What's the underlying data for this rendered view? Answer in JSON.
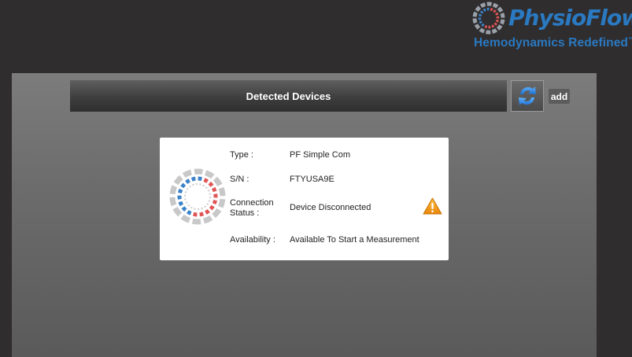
{
  "brand": {
    "name_part1": "Physio",
    "name_part2": "Flow",
    "registered": "®",
    "tagline": "Hemodynamics Redefined",
    "trademark": "™",
    "logo_icon": "physioflow-ring-logo",
    "colors": {
      "primary": "#2a79c1"
    }
  },
  "header": {
    "title": "Detected Devices",
    "refresh_icon": "refresh-icon",
    "add_label": "add"
  },
  "device": {
    "type_label": "Type :",
    "type_value": "PF Simple Com",
    "sn_label": "S/N :",
    "sn_value": "FTYUSA9E",
    "connection_label_line1": "Connection",
    "connection_label_line2": "Status :",
    "connection_value": "Device Disconnected",
    "availability_label": "Availability :",
    "availability_value": "Available To Start a Measurement",
    "status_icon": "warning-icon",
    "colors": {
      "warning": "#f0a020",
      "ring_blue": "#3b82c8",
      "ring_red": "#e05555",
      "ring_gray": "#c8c8c8"
    }
  }
}
